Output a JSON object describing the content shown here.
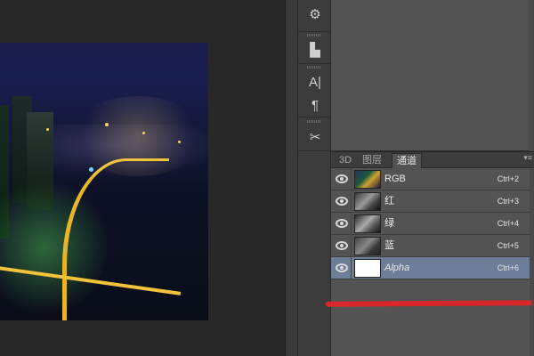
{
  "canvas": {
    "image": "city-night-photo"
  },
  "tools": [
    {
      "icon": "adjustments-icon",
      "glyph": "⚙"
    },
    {
      "icon": "stamp-icon",
      "glyph": "▙"
    },
    {
      "icon": "character-icon",
      "glyph": "A|"
    },
    {
      "icon": "paragraph-icon",
      "glyph": "¶"
    },
    {
      "icon": "tools-icon",
      "glyph": "✂"
    }
  ],
  "panel": {
    "tabs": [
      {
        "label": "3D"
      },
      {
        "label": "图层"
      },
      {
        "label": "通道",
        "active": true
      }
    ],
    "channels": [
      {
        "name": "RGB",
        "shortcut": "Ctrl+2"
      },
      {
        "name": "红",
        "shortcut": "Ctrl+3"
      },
      {
        "name": "绿",
        "shortcut": "Ctrl+4"
      },
      {
        "name": "蓝",
        "shortcut": "Ctrl+5"
      },
      {
        "name": "Alpha",
        "shortcut": "Ctrl+6",
        "selected": true
      }
    ]
  },
  "annotation_color": "#d8262a",
  "selection_color": "#6e7d98"
}
